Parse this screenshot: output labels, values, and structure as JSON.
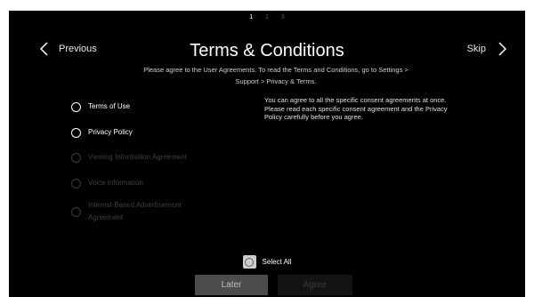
{
  "steps": [
    "1",
    "2",
    "3"
  ],
  "nav": {
    "previous_label": "Previous",
    "skip_label": "Skip"
  },
  "header": {
    "title": "Terms & Conditions",
    "subtitle_line1": "Please agree to the User Agreements. To read the Terms and Conditions, go to Settings >",
    "subtitle_line2": "Support > Privacy & Terms."
  },
  "options": [
    {
      "label": "Terms of Use",
      "enabled": true
    },
    {
      "label": "Privacy Policy",
      "enabled": true
    },
    {
      "label": "Viewing Information Agreement",
      "enabled": false
    },
    {
      "label": "Voice Information",
      "enabled": false
    },
    {
      "label_line1": "Interest-Based Advertisement",
      "label_line2": "Agreement",
      "enabled": false
    }
  ],
  "info": {
    "line1": "You can agree to all the specific consent agreements at once.",
    "line2": "Please read each specific consent agreement and the Privacy",
    "line3": "Policy carefully before you agree."
  },
  "select_all_label": "Select All",
  "buttons": {
    "later_label": "Later",
    "agree_label": "Agree"
  },
  "colors": {
    "background": "#000000",
    "text": "#ffffff",
    "disabled_text": "#3e3e3e",
    "later_button": "#4d4d4d"
  }
}
